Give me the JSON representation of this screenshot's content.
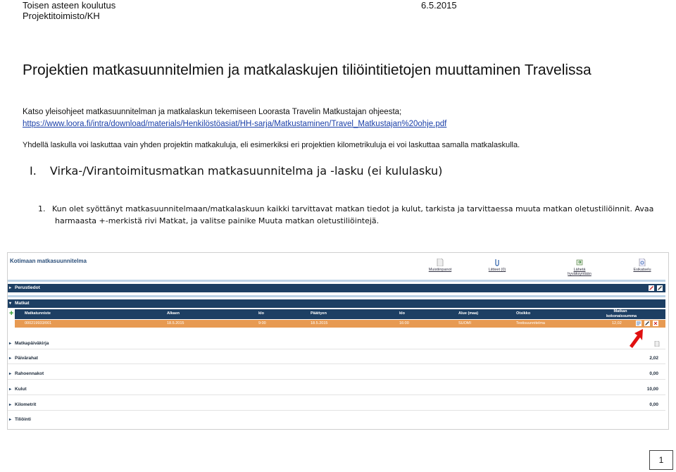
{
  "header": {
    "org": "Toisen asteen koulutus",
    "unit": "Projektitoimisto/KH",
    "date": "6.5.2015"
  },
  "title": "Projektien matkasuunnitelmien ja matkalaskujen tiliöintitietojen muuttaminen Travelissa",
  "intro": "Katso yleisohjeet matkasuunnitelman ja matkalaskun tekemiseen Loorasta Travelin Matkustajan ohjeesta;",
  "link": "https://www.loora.fi/intra/download/materials/Henkilöstöasiat/HH-sarja/Matkustaminen/Travel_Matkustajan%20ohje.pdf",
  "note": "Yhdellä laskulla voi laskuttaa vain yhden projektin matkakuluja, eli esimerkiksi eri projektien kilometrikuluja ei voi laskuttaa samalla matkalaskulla.",
  "section": {
    "number": "I.",
    "title": "Virka-/Virantoimitusmatkan matkasuunnitelma ja -lasku (ei kululasku)"
  },
  "step1": {
    "number": "1.",
    "line1": "Kun olet syöttänyt matkasuunnitelmaan/matkalaskuun kaikki tarvittavat matkan tiedot ja kulut, tarkista ja tarvittaessa muuta matkan oletustiliöinnit.  Avaa",
    "line2": "harmaasta +-merkistä rivi Matkat, ja valitse painike Muuta matkan oletustiliöintejä."
  },
  "screenshot": {
    "title": "Kotimaan matkasuunnitelma",
    "toolbar": [
      "Muistiinpanot",
      "Liitteet (0)",
      "Lähetä hyväksyntään",
      "Esikatselu"
    ],
    "perustiedot": "Perustiedot",
    "matkat": "Matkat",
    "columns": [
      "Matkatunniste",
      "Alkaen",
      "klo",
      "Päättyen",
      "klo",
      "Alue (maa)",
      "Otsikko",
      "Matkan kokonaissumma"
    ],
    "trip": [
      "000219933/001",
      "18.5.2015",
      "9:00",
      "18.5.2015",
      "16:00",
      "SUOMI",
      "Testisuunnitelma",
      "12,02"
    ],
    "rows": [
      {
        "label": "Matkapäiväkirja",
        "value": ""
      },
      {
        "label": "Päivärahat",
        "value": "2,02"
      },
      {
        "label": "Rahoennakot",
        "value": "0,00"
      },
      {
        "label": "Kulut",
        "value": "10,00"
      },
      {
        "label": "Kilometrit",
        "value": "0,00"
      },
      {
        "label": "Tiliöinti",
        "value": ""
      }
    ]
  },
  "page_number": "1",
  "colors": {
    "bar": "#1d3f63",
    "trip_row": "#e79a52",
    "arrow": "#e01010",
    "link": "#1a3fa8"
  }
}
